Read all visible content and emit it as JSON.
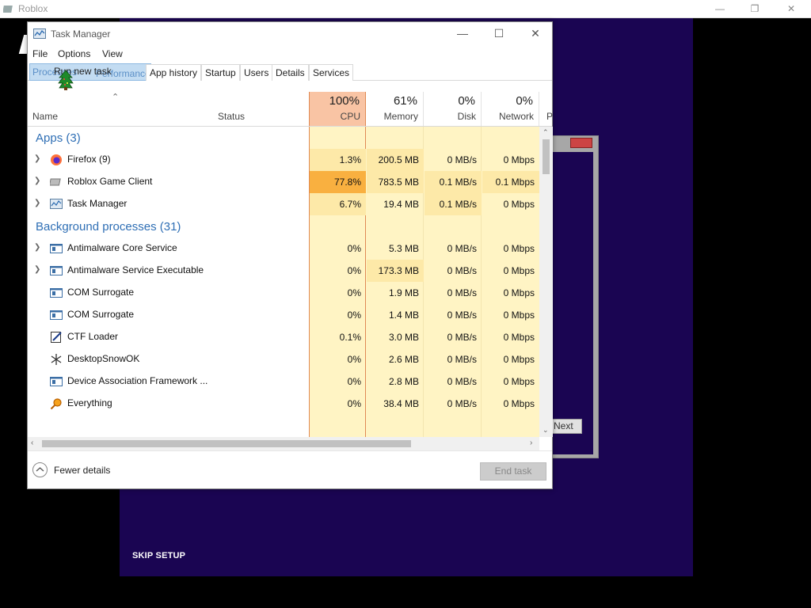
{
  "window": {
    "title": "Roblox"
  },
  "setup": {
    "skip_label": "SKIP SETUP",
    "next_label": "Next"
  },
  "task_manager": {
    "title": "Task Manager",
    "menu": [
      "File",
      "Options",
      "View"
    ],
    "context_menu_item": "Run new task",
    "tabs": [
      "Processes",
      "Performance",
      "App history",
      "Startup",
      "Users",
      "Details",
      "Services"
    ],
    "columns": {
      "name": "Name",
      "status": "Status",
      "cpu": {
        "pct": "100%",
        "label": "CPU"
      },
      "memory": {
        "pct": "61%",
        "label": "Memory"
      },
      "disk": {
        "pct": "0%",
        "label": "Disk"
      },
      "network": {
        "pct": "0%",
        "label": "Network"
      },
      "power": "P"
    },
    "groups": {
      "apps": "Apps (3)",
      "background": "Background processes (31)"
    },
    "apps": [
      {
        "name": "Firefox (9)",
        "icon": "firefox-icon",
        "expandable": true,
        "cpu": "1.3%",
        "memory": "200.5 MB",
        "disk": "0 MB/s",
        "network": "0 Mbps"
      },
      {
        "name": "Roblox Game Client",
        "icon": "roblox-icon",
        "expandable": true,
        "cpu": "77.8%",
        "memory": "783.5 MB",
        "disk": "0.1 MB/s",
        "network": "0.1 Mbps"
      },
      {
        "name": "Task Manager",
        "icon": "task-manager-icon",
        "expandable": true,
        "cpu": "6.7%",
        "memory": "19.4 MB",
        "disk": "0.1 MB/s",
        "network": "0 Mbps"
      }
    ],
    "background": [
      {
        "name": "Antimalware Core Service",
        "icon": "service-icon",
        "expandable": true,
        "cpu": "0%",
        "memory": "5.3 MB",
        "disk": "0 MB/s",
        "network": "0 Mbps"
      },
      {
        "name": "Antimalware Service Executable",
        "icon": "service-icon",
        "expandable": true,
        "cpu": "0%",
        "memory": "173.3 MB",
        "disk": "0 MB/s",
        "network": "0 Mbps"
      },
      {
        "name": "COM Surrogate",
        "icon": "service-icon",
        "expandable": false,
        "cpu": "0%",
        "memory": "1.9 MB",
        "disk": "0 MB/s",
        "network": "0 Mbps"
      },
      {
        "name": "COM Surrogate",
        "icon": "service-icon",
        "expandable": false,
        "cpu": "0%",
        "memory": "1.4 MB",
        "disk": "0 MB/s",
        "network": "0 Mbps"
      },
      {
        "name": "CTF Loader",
        "icon": "ctf-loader-icon",
        "expandable": false,
        "cpu": "0.1%",
        "memory": "3.0 MB",
        "disk": "0 MB/s",
        "network": "0 Mbps"
      },
      {
        "name": "DesktopSnowOK",
        "icon": "snowflake-icon",
        "expandable": false,
        "cpu": "0%",
        "memory": "2.6 MB",
        "disk": "0 MB/s",
        "network": "0 Mbps"
      },
      {
        "name": "Device Association Framework ...",
        "icon": "service-icon",
        "expandable": false,
        "cpu": "0%",
        "memory": "2.8 MB",
        "disk": "0 MB/s",
        "network": "0 Mbps"
      },
      {
        "name": "Everything",
        "icon": "magnifier-icon",
        "expandable": false,
        "cpu": "0%",
        "memory": "38.4 MB",
        "disk": "0 MB/s",
        "network": "0 Mbps"
      }
    ],
    "footer": {
      "fewer_details": "Fewer details",
      "end_task": "End task"
    },
    "colors": {
      "cpu_header": "#f9c4a4",
      "cpu_high": "#f9b040",
      "heat_light": "#fff4c4",
      "heat_mid": "#fde9a8",
      "group_text": "#2f6fb5"
    }
  }
}
